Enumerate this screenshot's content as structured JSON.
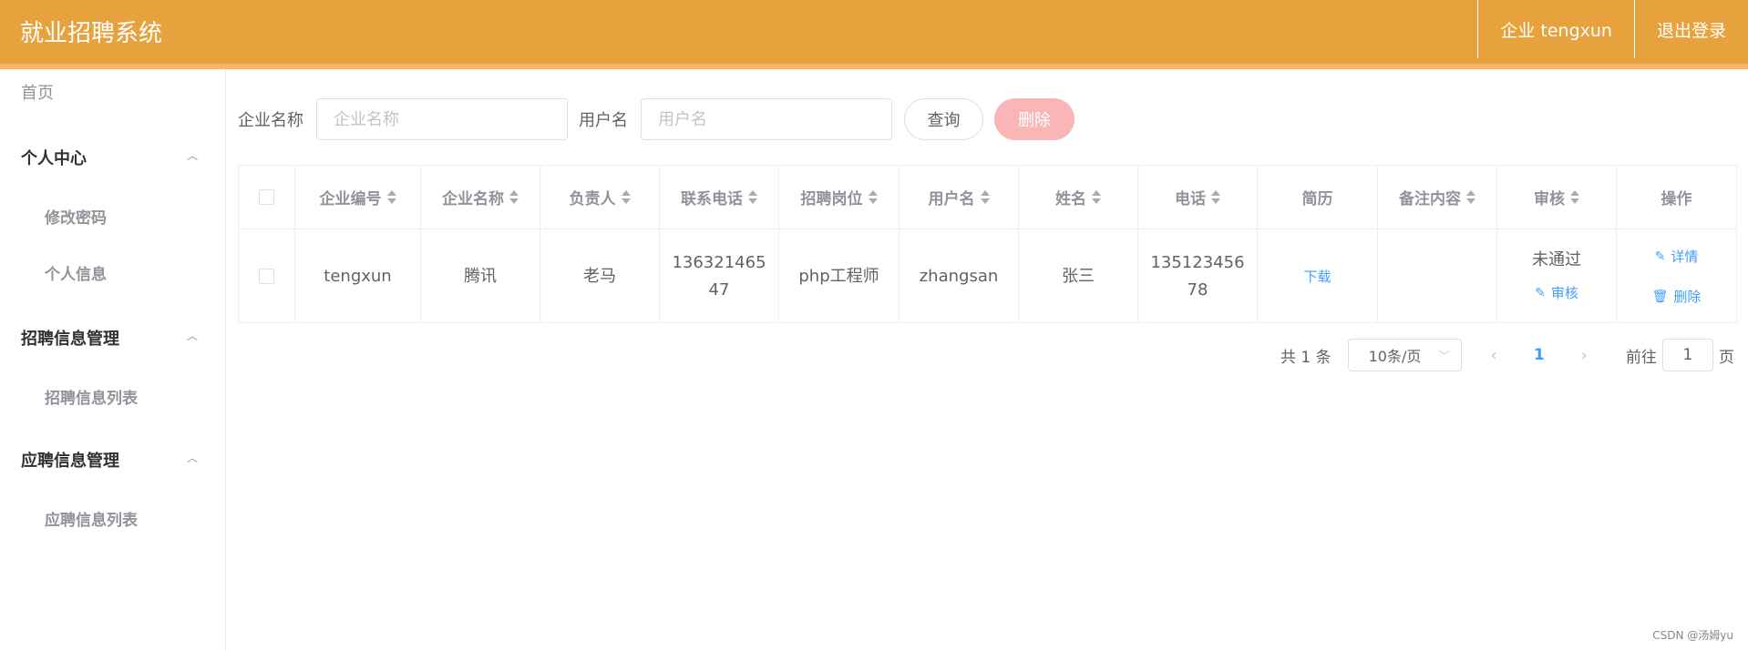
{
  "header": {
    "title": "就业招聘系统",
    "user_label": "企业 tengxun",
    "logout_label": "退出登录"
  },
  "sidebar": {
    "home": "首页",
    "groups": [
      {
        "title": "个人中心",
        "items": [
          "修改密码",
          "个人信息"
        ]
      },
      {
        "title": "招聘信息管理",
        "items": [
          "招聘信息列表"
        ]
      },
      {
        "title": "应聘信息管理",
        "items": [
          "应聘信息列表"
        ]
      }
    ]
  },
  "search": {
    "company_label": "企业名称",
    "company_placeholder": "企业名称",
    "username_label": "用户名",
    "username_placeholder": "用户名",
    "query_button": "查询",
    "delete_button": "删除"
  },
  "table": {
    "columns": [
      "企业编号",
      "企业名称",
      "负责人",
      "联系电话",
      "招聘岗位",
      "用户名",
      "姓名",
      "电话",
      "简历",
      "备注内容",
      "审核",
      "操作"
    ],
    "rows": [
      {
        "company_id": "tengxun",
        "company_name": "腾讯",
        "manager": "老马",
        "contact_phone": "13632146547",
        "position": "php工程师",
        "username": "zhangsan",
        "name": "张三",
        "phone": "13512345678",
        "resume": "下载",
        "remark": "",
        "review_status": "未通过",
        "review_action": "审核",
        "detail_action": "详情",
        "delete_action": "删除"
      }
    ]
  },
  "pagination": {
    "total_text": "共 1 条",
    "page_size": "10条/页",
    "current_page": "1",
    "goto_label": "前往",
    "goto_value": "1",
    "page_suffix": "页"
  },
  "watermark": "CSDN @汤姆yu",
  "colors": {
    "header_bg": "#e7a23d",
    "header_border": "#f7b46a",
    "link": "#409eff",
    "delete_button": "#fab6b6"
  }
}
